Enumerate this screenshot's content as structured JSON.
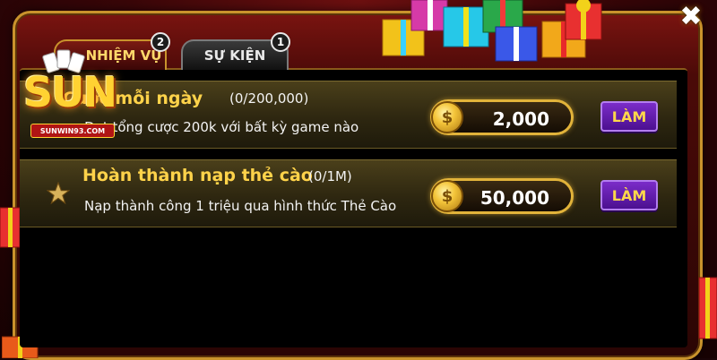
{
  "logo": {
    "text": "SUN",
    "subtext": "SUNWIN93.COM"
  },
  "tabs": [
    {
      "label": "NHIỆM VỤ",
      "badge": "2",
      "active": true
    },
    {
      "label": "SỰ KIỆN",
      "badge": "1",
      "active": false
    }
  ],
  "close": {
    "icon": "close-icon",
    "symbol": "✖"
  },
  "tasks": [
    {
      "title": "Cược mỗi ngày",
      "progress": "(0/200,000)",
      "description": "Đạt tổng cược 200k với bất kỳ game nào",
      "reward": "2,000",
      "button": "LÀM",
      "icon": ""
    },
    {
      "title": "Hoàn thành nạp thẻ cào",
      "progress": "(0/1M)",
      "description": "Nạp thành công 1 triệu qua hình thức Thẻ Cào",
      "reward": "50,000",
      "button": "LÀM",
      "icon": "star-icon"
    }
  ],
  "colors": {
    "accent_gold": "#ffd34a",
    "button_purple": "#6a1fb8",
    "frame_red": "#7a1410"
  }
}
